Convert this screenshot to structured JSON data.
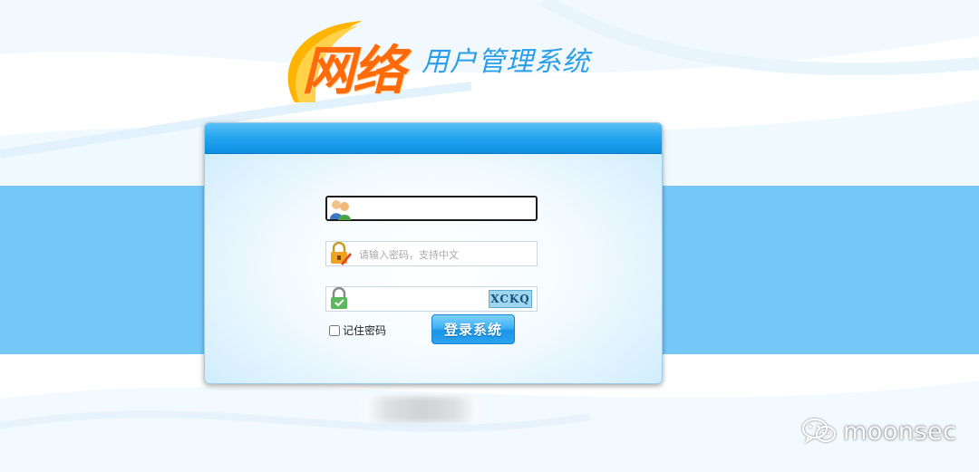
{
  "logo": {
    "title_big": "网络",
    "title_small": "用户管理系统"
  },
  "login": {
    "username": {
      "value": "",
      "placeholder": "",
      "icon": "user-icon"
    },
    "password": {
      "value": "",
      "placeholder": "请输入密码，支持中文",
      "icon": "lock-pencil-icon"
    },
    "captcha": {
      "value": "",
      "placeholder": "",
      "icon": "lock-check-icon",
      "image_text": "XCKQ"
    },
    "remember_label": "记住密码",
    "remember_checked": false,
    "submit_label": "登录系统"
  },
  "watermark": {
    "text": "moonsec",
    "icon": "wechat-icon"
  },
  "colors": {
    "band": "#74c8f8",
    "panel_header": "#26a6f0",
    "logo_orange": "#ff6a0a",
    "logo_blue": "#2a9ee8",
    "button": "#1a95e6"
  }
}
